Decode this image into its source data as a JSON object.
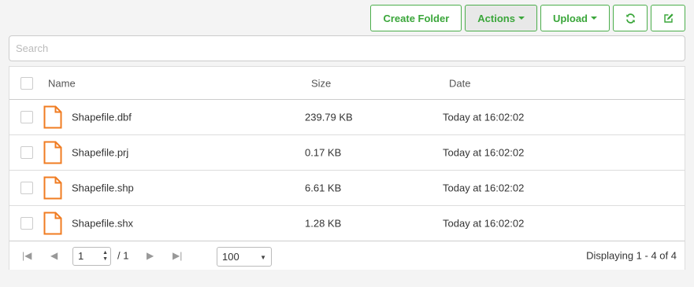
{
  "toolbar": {
    "create_folder": "Create Folder",
    "actions": "Actions",
    "upload": "Upload",
    "refresh_icon": "refresh-icon",
    "edit_icon": "edit-icon"
  },
  "search": {
    "placeholder": "Search",
    "value": ""
  },
  "table": {
    "columns": {
      "name": "Name",
      "size": "Size",
      "date": "Date"
    },
    "rows": [
      {
        "name": "Shapefile.dbf",
        "size": "239.79 KB",
        "date": "Today at 16:02:02"
      },
      {
        "name": "Shapefile.prj",
        "size": "0.17 KB",
        "date": "Today at 16:02:02"
      },
      {
        "name": "Shapefile.shp",
        "size": "6.61 KB",
        "date": "Today at 16:02:02"
      },
      {
        "name": "Shapefile.shx",
        "size": "1.28 KB",
        "date": "Today at 16:02:02"
      }
    ]
  },
  "pager": {
    "page": "1",
    "total": "/ 1",
    "page_size": "100",
    "display": "Displaying 1 - 4 of 4"
  },
  "colors": {
    "accent": "#3aa63a",
    "file_icon": "#f07c22"
  }
}
